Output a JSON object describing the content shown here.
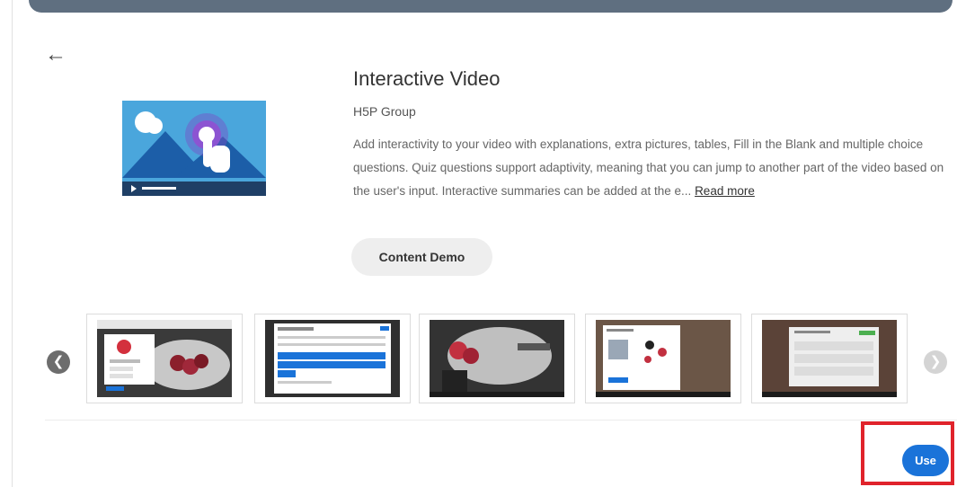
{
  "content_type": {
    "title": "Interactive Video",
    "author": "H5P Group",
    "description": "Add interactivity to your video with explanations, extra pictures, tables, Fill in the Blank and multiple choice questions. Quiz questions support adaptivity, meaning that you can jump to another part of the video based on the user's input. Interactive summaries can be added at the e...",
    "read_more_label": "Read more",
    "demo_button_label": "Content Demo"
  },
  "navigation": {
    "back_icon": "arrow-left-icon",
    "prev_icon": "chevron-left-icon",
    "next_icon": "chevron-right-icon"
  },
  "screenshots": {
    "count": 5
  },
  "actions": {
    "use_button_label": "Use"
  },
  "colors": {
    "accent": "#1a73d9",
    "highlight": "#e0232b",
    "hero_bg": "#4aa6dc",
    "top_bar": "#5f6f80"
  }
}
